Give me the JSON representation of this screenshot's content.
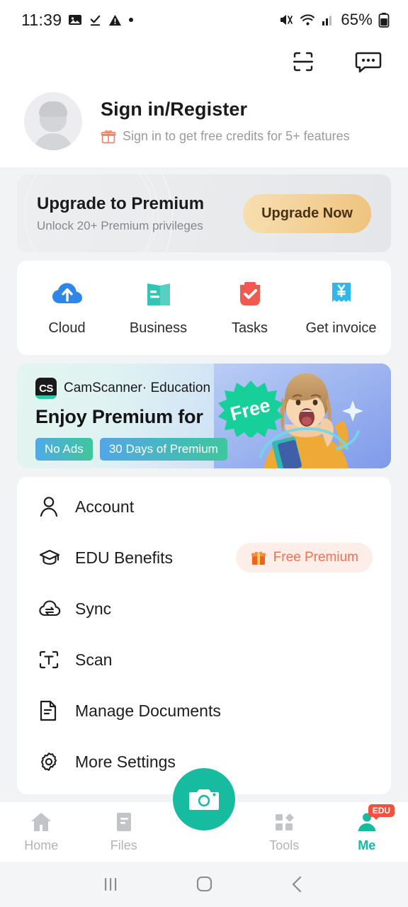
{
  "status_bar": {
    "time": "11:39",
    "battery": "65%",
    "left_icons": [
      "image-icon",
      "download-complete-icon",
      "warning-icon",
      "dot-icon"
    ],
    "right_icons": [
      "mute-icon",
      "wifi-icon",
      "signal-icon",
      "battery-icon"
    ]
  },
  "top_bar": {
    "scan_split_label": "scan-split",
    "messages_label": "messages"
  },
  "profile": {
    "title": "Sign in/Register",
    "subtitle": "Sign in to get free credits for 5+ features"
  },
  "premium": {
    "heading": "Upgrade to Premium",
    "subheading": "Unlock 20+ Premium privileges",
    "button": "Upgrade Now",
    "button_color": "#eec37c"
  },
  "quick_actions": [
    {
      "label": "Cloud",
      "icon": "cloud-upload-icon",
      "color": "#2f86e8"
    },
    {
      "label": "Business",
      "icon": "business-doc-icon",
      "color": "#2fc6b5"
    },
    {
      "label": "Tasks",
      "icon": "tasks-check-icon",
      "color": "#f4594f"
    },
    {
      "label": "Get invoice",
      "icon": "invoice-yen-icon",
      "color": "#2fb8e8"
    }
  ],
  "edu_banner": {
    "logo_text": "CS",
    "brand": "CamScanner·",
    "category": "Education",
    "headline": "Enjoy Premium for",
    "burst_text": "Free",
    "tags": [
      "No Ads",
      "30 Days of Premium"
    ]
  },
  "menu": [
    {
      "label": "Account",
      "icon": "person-icon",
      "badge": null
    },
    {
      "label": "EDU Benefits",
      "icon": "graduation-cap-icon",
      "badge": "Free Premium"
    },
    {
      "label": "Sync",
      "icon": "sync-cloud-icon",
      "badge": null
    },
    {
      "label": "Scan",
      "icon": "scan-text-icon",
      "badge": null
    },
    {
      "label": "Manage Documents",
      "icon": "document-icon",
      "badge": null
    },
    {
      "label": "More Settings",
      "icon": "gear-icon",
      "badge": null
    }
  ],
  "bottom_nav": {
    "items": [
      {
        "label": "Home",
        "icon": "home-icon",
        "active": false
      },
      {
        "label": "Files",
        "icon": "files-icon",
        "active": false
      },
      {
        "label": "Tools",
        "icon": "tools-grid-icon",
        "active": false
      },
      {
        "label": "Me",
        "icon": "person-icon",
        "active": true,
        "badge": "EDU"
      }
    ],
    "camera_button": "camera-icon",
    "accent_color": "#17bba0"
  },
  "android_nav": {
    "recents": "recents-icon",
    "home": "home-square-icon",
    "back": "back-chevron-icon"
  }
}
